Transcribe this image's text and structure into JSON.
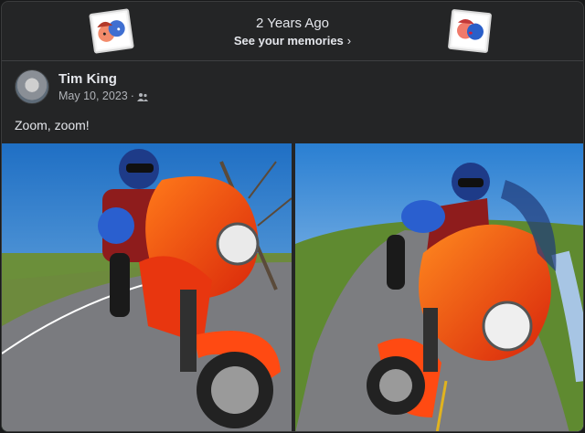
{
  "memory": {
    "title": "2 Years Ago",
    "link_label": "See your memories"
  },
  "post": {
    "author": "Tim King",
    "date": "May 10, 2023",
    "separator": "·",
    "text": "Zoom, zoom!"
  },
  "photos": [
    {
      "subject": "orange-motorcycle-rider-left"
    },
    {
      "subject": "orange-motorcycle-rider-right"
    }
  ],
  "colors": {
    "background": "#242526",
    "text_primary": "#e4e6eb",
    "text_secondary": "#b0b3b8",
    "motorcycle_orange": "#ff4a12",
    "sky_blue": "#2f86d6"
  }
}
